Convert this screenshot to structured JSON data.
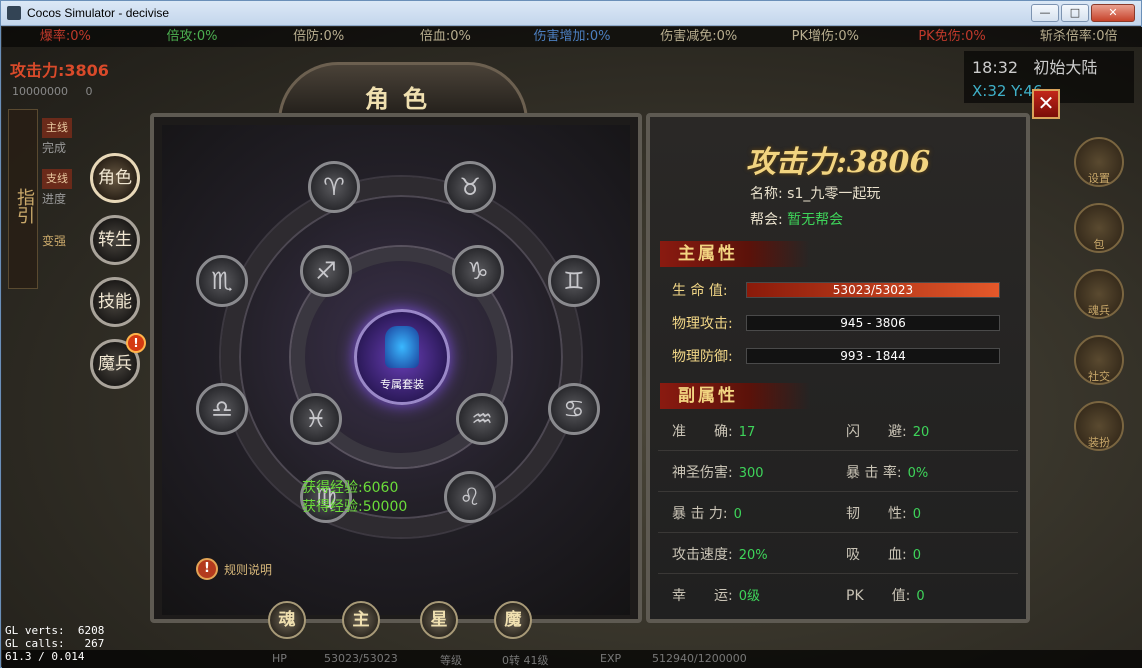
{
  "window": {
    "title": "Cocos Simulator - decivise",
    "minimize": "—",
    "maximize": "□",
    "close": "✕"
  },
  "statbar": [
    {
      "label": "爆率:0%",
      "color": "r"
    },
    {
      "label": "倍攻:0%",
      "color": "g"
    },
    {
      "label": "倍防:0%",
      "color": ""
    },
    {
      "label": "倍血:0%",
      "color": ""
    },
    {
      "label": "伤害增加:0%",
      "color": "b"
    },
    {
      "label": "伤害减免:0%",
      "color": ""
    },
    {
      "label": "PK增伤:0%",
      "color": ""
    },
    {
      "label": "PK免伤:0%",
      "color": "r"
    },
    {
      "label": "斩杀倍率:0倍",
      "color": ""
    }
  ],
  "hud": {
    "attack": "攻击力:3806",
    "gold": "10000000",
    "gems": "0",
    "leftstrip_top": "指引",
    "leftstrip_bottom": "变强",
    "quest_main_tag": "主线",
    "quest_main_status": "完成",
    "quest_side_tag": "支线",
    "quest_side_status": "进度",
    "map_time": "18:32",
    "map_name": "初始大陆",
    "map_coords": "X:32  Y:46",
    "right_buttons": [
      "设置",
      "包",
      "魂兵",
      "社交",
      "装扮"
    ],
    "hp": "HP",
    "hp_val": "53023/53023",
    "level_label": "等级",
    "level_val": "0转 41级",
    "exp_label": "EXP",
    "exp_val": "512940/1200000"
  },
  "debug": "GL verts:  6208\nGL calls:   267\n61.3 / 0.014",
  "panel": {
    "title": "角色",
    "nav": [
      {
        "label": "角色",
        "active": true
      },
      {
        "label": "转生",
        "active": false
      },
      {
        "label": "技能",
        "active": false
      },
      {
        "label": "魔兵",
        "active": false,
        "badge": "!"
      }
    ],
    "core_label": "专属套装",
    "zodiac": [
      "♈",
      "♉",
      "♏",
      "♐",
      "♑",
      "♊",
      "♎",
      "♓",
      "♒",
      "♋",
      "♍",
      "♌"
    ],
    "exp_lines": [
      "获得经验:6060",
      "获得经验:50000"
    ],
    "rule": "规则说明",
    "rule_icon": "!",
    "tabs": [
      "魂",
      "主",
      "星",
      "魔"
    ],
    "close": "✕"
  },
  "stats": {
    "power": "攻击力:3806",
    "name_label": "名称:",
    "name_value": "s1_九零一起玩",
    "guild_label": "帮会:",
    "guild_value": "暂无帮会",
    "main_title": "主属性",
    "main": [
      {
        "label": "生 命 值:",
        "value": "53023/53023"
      },
      {
        "label": "物理攻击:",
        "value": "945 - 3806"
      },
      {
        "label": "物理防御:",
        "value": "993 - 1844"
      }
    ],
    "sub_title": "副属性",
    "sub": [
      {
        "label": "准　　确:",
        "value": "17"
      },
      {
        "label": "闪　　避:",
        "value": "20"
      },
      {
        "label": "神圣伤害:",
        "value": "300"
      },
      {
        "label": "暴 击 率:",
        "value": "0%"
      },
      {
        "label": "暴 击 力:",
        "value": "0"
      },
      {
        "label": "韧　　性:",
        "value": "0"
      },
      {
        "label": "攻击速度:",
        "value": "20%"
      },
      {
        "label": "吸　　血:",
        "value": "0"
      },
      {
        "label": "幸　　运:",
        "value": "0级"
      },
      {
        "label": "PK　　值:",
        "value": "0"
      }
    ]
  }
}
